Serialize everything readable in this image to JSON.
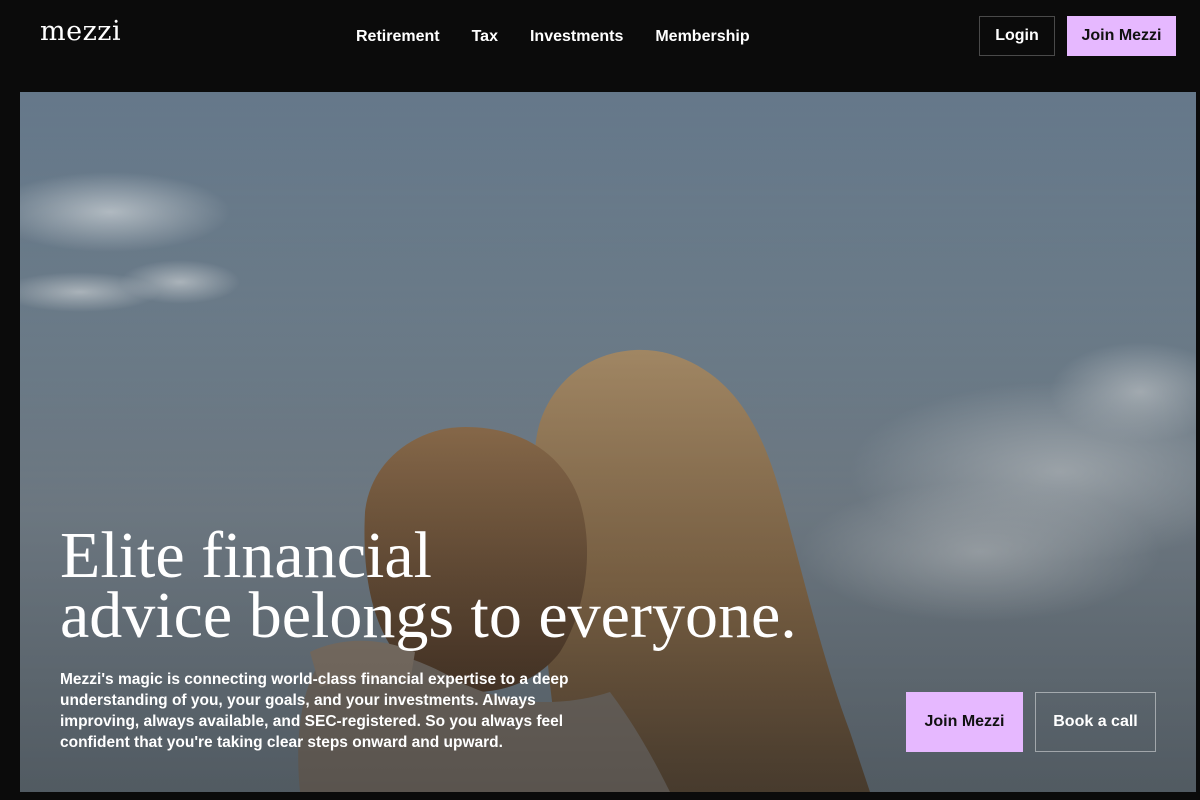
{
  "brand": {
    "logo_text": "mezzi"
  },
  "nav": {
    "items": [
      {
        "label": "Retirement"
      },
      {
        "label": "Tax"
      },
      {
        "label": "Investments"
      },
      {
        "label": "Membership"
      }
    ]
  },
  "header": {
    "login_label": "Login",
    "join_label": "Join Mezzi"
  },
  "hero": {
    "headline_line1": "Elite financial",
    "headline_line2": "advice belongs to everyone.",
    "body": "Mezzi's magic is connecting world-class financial expertise to a deep understanding of you, your goals, and your investments. Always improving, always available, and SEC-registered. So you always feel confident that you're taking clear steps onward and upward.",
    "primary_cta": "Join Mezzi",
    "secondary_cta": "Book a call"
  },
  "colors": {
    "accent": "#e6b8ff",
    "background": "#0b0b0b",
    "text": "#ffffff"
  }
}
